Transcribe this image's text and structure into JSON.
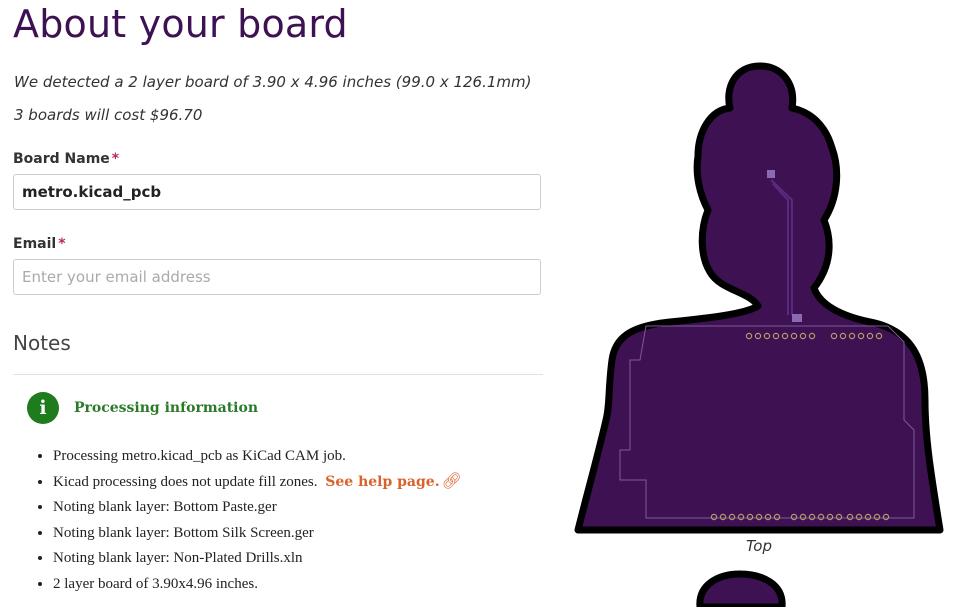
{
  "page": {
    "title": "About your board",
    "detect_text": "We detected a 2 layer board of 3.90 x 4.96 inches (99.0 x 126.1mm)",
    "cost_text": "3 boards will cost $96.70"
  },
  "form": {
    "name_label": "Board Name",
    "name_value": "metro.kicad_pcb",
    "email_label": "Email",
    "email_placeholder": "Enter your email address",
    "required_mark": "*"
  },
  "notes": {
    "heading": "Notes",
    "info_icon_glyph": "i",
    "info_title": "Processing information",
    "items": [
      "Processing metro.kicad_pcb as KiCad CAM job.",
      "Kicad processing does not update fill zones.",
      "Noting blank layer: Bottom Paste.ger",
      "Noting blank layer: Bottom Silk Screen.ger",
      "Noting blank layer: Non-Plated Drills.xln",
      "2 layer board of 3.90x4.96 inches."
    ],
    "help_link": "See help page.",
    "link_icon": "link-icon"
  },
  "preview": {
    "caption": "Top",
    "board_color": "#3d1152",
    "outline_color": "#000000"
  },
  "colors": {
    "title": "#3d1152",
    "required": "#b7295a",
    "info_green": "#1e7b1e",
    "link_orange": "#d9622b"
  }
}
